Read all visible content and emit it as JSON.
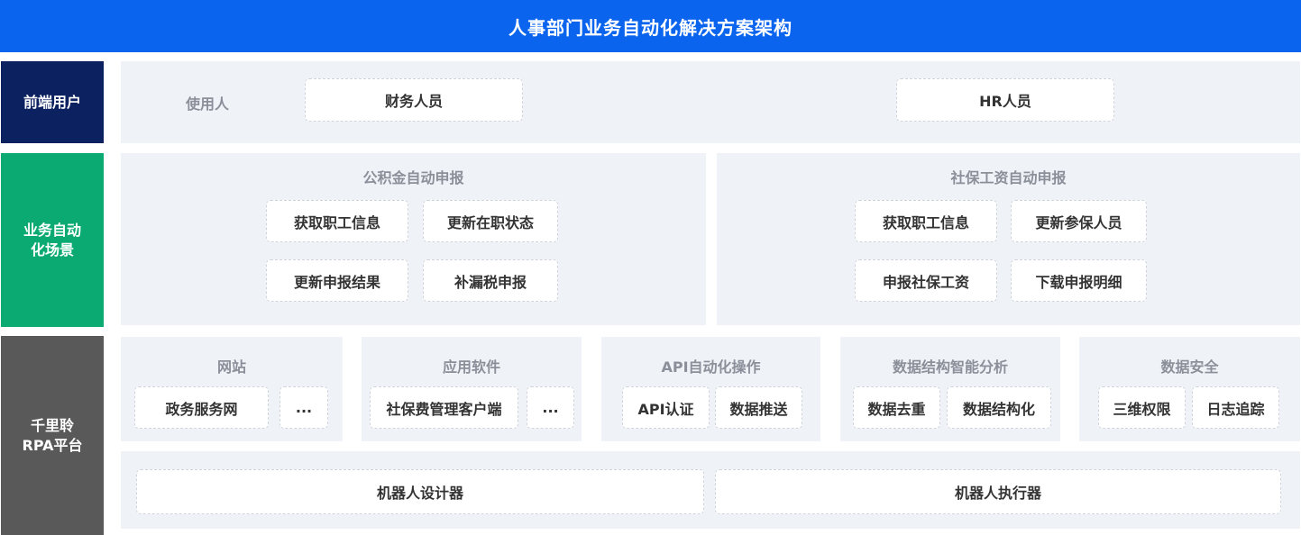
{
  "title": "人事部门业务自动化解决方案架构",
  "colors": {
    "title_bg": "#0a64ee",
    "frontend_label_bg": "#0b2160",
    "scenario_label_bg": "#0aaa72",
    "platform_label_bg": "#595959",
    "panel_bg": "#eff2f7"
  },
  "frontend": {
    "label": "前端用户",
    "user_label": "使用人",
    "users": [
      "财务人员",
      "HR人员"
    ]
  },
  "scenarios": {
    "label": "业务自动化场景",
    "groups": [
      {
        "title": "公积金自动申报",
        "items": [
          "获取职工信息",
          "更新在职状态",
          "更新申报结果",
          "补漏税申报"
        ]
      },
      {
        "title": "社保工资自动申报",
        "items": [
          "获取职工信息",
          "更新参保人员",
          "申报社保工资",
          "下载申报明细"
        ]
      }
    ]
  },
  "platform": {
    "label": "千里聆RPA平台",
    "modules": [
      {
        "title": "网站",
        "items": [
          "政务服务网",
          "..."
        ]
      },
      {
        "title": "应用软件",
        "items": [
          "社保费管理客户端",
          "..."
        ]
      },
      {
        "title": "API自动化操作",
        "items": [
          "API认证",
          "数据推送"
        ]
      },
      {
        "title": "数据结构智能分析",
        "items": [
          "数据去重",
          "数据结构化"
        ]
      },
      {
        "title": "数据安全",
        "items": [
          "三维权限",
          "日志追踪"
        ]
      }
    ],
    "robots": [
      "机器人设计器",
      "机器人执行器"
    ]
  }
}
